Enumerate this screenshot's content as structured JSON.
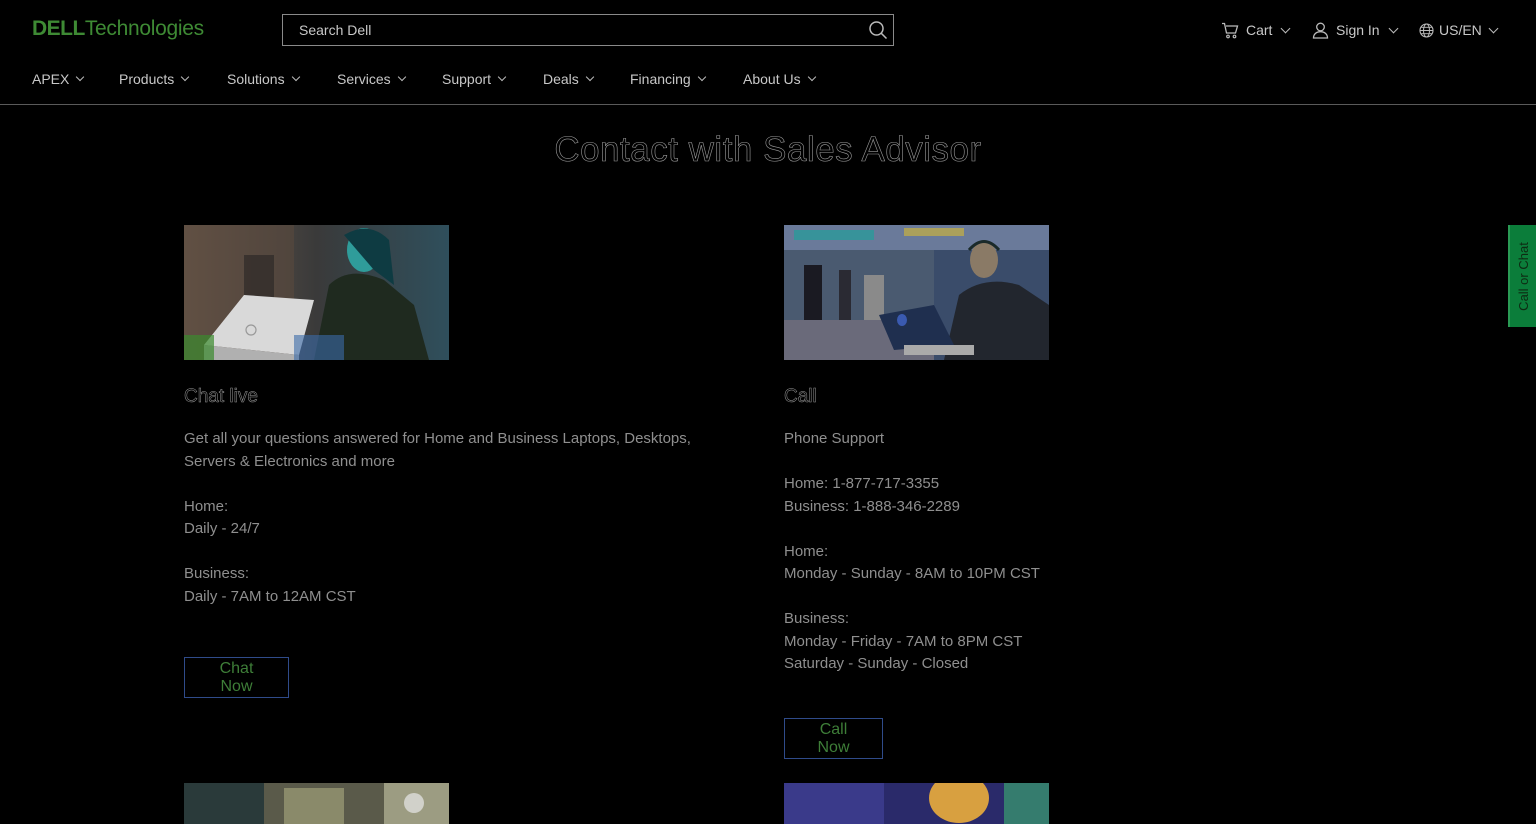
{
  "header": {
    "logo_brand": "DELL",
    "logo_sub": "Technologies",
    "search_placeholder": "Search Dell",
    "cart_label": "Cart",
    "signin_label": "Sign In",
    "locale_label": "US/EN"
  },
  "nav": {
    "items": [
      "APEX",
      "Products",
      "Solutions",
      "Services",
      "Support",
      "Deals",
      "Financing",
      "About Us"
    ]
  },
  "main": {
    "title": "Contact with Sales Advisor",
    "chat": {
      "title": "Chat live",
      "body": "Get all your questions answered for Home and Business Laptops, Desktops, Servers & Electronics and more\n\nHome:\nDaily - 24/7\n\nBusiness:\nDaily - 7AM to 12AM  CST",
      "button": "Chat Now"
    },
    "call": {
      "title": "Call",
      "body": "Phone Support\n\nHome: 1-877-717-3355\nBusiness: 1-888-346-2289\n\nHome:\nMonday - Sunday - 8AM to 10PM CST\n\nBusiness:\nMonday - Friday - 7AM to 8PM CST\nSaturday - Sunday - Closed",
      "button": "Call Now"
    }
  },
  "side_tab": {
    "label": "Call or Chat"
  },
  "colors": {
    "background": "#000000",
    "brand_green": "#3e8a34",
    "button_border": "#2f4b8a",
    "side_tab": "#0b7d3a"
  },
  "icons": [
    "search-icon",
    "cart-icon",
    "user-icon",
    "globe-icon",
    "chevron-down-icon"
  ]
}
